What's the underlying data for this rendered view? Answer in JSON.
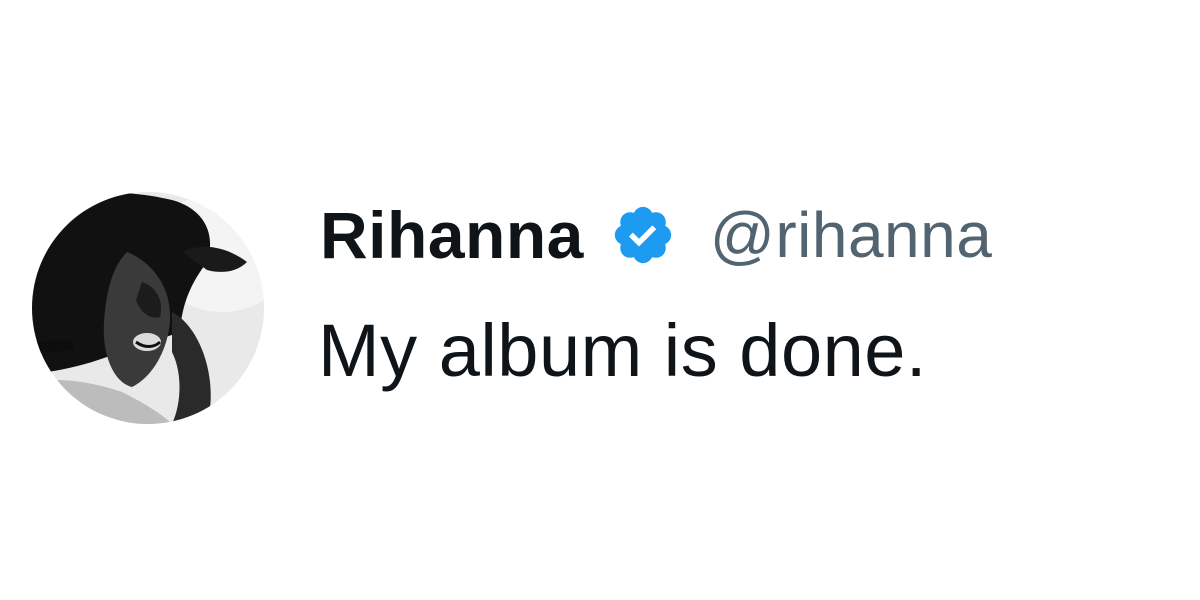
{
  "tweet": {
    "author": {
      "display_name": "Rihanna",
      "handle": "@rihanna",
      "verified": true,
      "verified_icon": "verified-badge-icon",
      "avatar": "profile-photo-black-and-white"
    },
    "text": "My album is done."
  },
  "colors": {
    "background": "#ffffff",
    "primary_text": "#0f1419",
    "secondary_text": "#536471",
    "verified_blue": "#1d9bf0"
  }
}
